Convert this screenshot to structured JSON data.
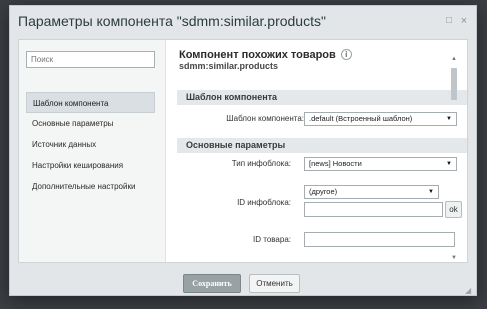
{
  "dialog": {
    "title": "Параметры компонента \"sdmm:similar.products\"",
    "expand_icon": "□",
    "close_icon": "×"
  },
  "sidebar": {
    "search_placeholder": "Поиск",
    "items": [
      {
        "label": "Шаблон компонента",
        "active": true
      },
      {
        "label": "Основные параметры",
        "active": false
      },
      {
        "label": "Источник данных",
        "active": false
      },
      {
        "label": "Настройки кеширования",
        "active": false
      },
      {
        "label": "Дополнительные настройки",
        "active": false
      }
    ]
  },
  "component": {
    "title": "Компонент похожих товаров",
    "info_icon": "i",
    "code": "sdmm:similar.products"
  },
  "sections": {
    "template": "Шаблон компонента",
    "basic": "Основные параметры"
  },
  "fields": {
    "template_label": "Шаблон компонента:",
    "template_value": ".default (Встроенный шаблон)",
    "iblock_type_label": "Тип инфоблока:",
    "iblock_type_value": "[news] Новости",
    "iblock_id_label": "ID инфоблока:",
    "iblock_id_value": "(другое)",
    "iblock_id_input": "",
    "ok_label": "ok",
    "product_id_label": "ID товара:",
    "product_id_input": ""
  },
  "footer": {
    "save_label": "Сохранить",
    "cancel_label": "Отменить"
  },
  "icons": {
    "dropdown_arrow": "▼",
    "scroll_up": "▲",
    "scroll_down": "▼"
  },
  "colors": {
    "backdrop": "#3b3f44",
    "dialog_bg": "#e2e6e8",
    "section_bg": "#e4e8ea",
    "save_button": "#98a1a4"
  }
}
